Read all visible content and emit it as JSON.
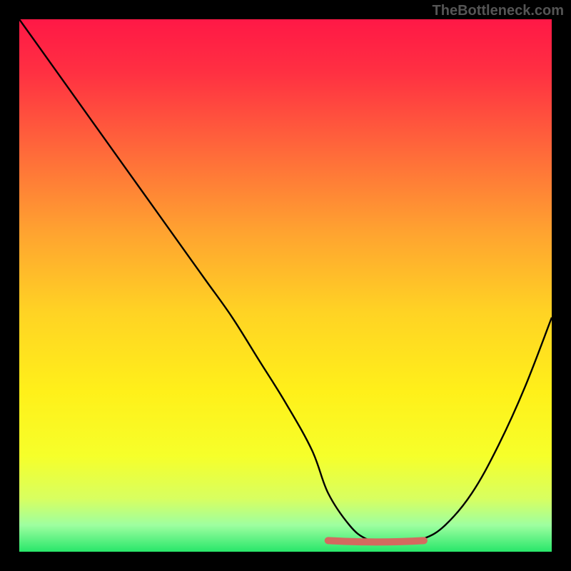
{
  "watermark": "TheBottleneck.com",
  "chart_data": {
    "type": "line",
    "title": "",
    "xlabel": "",
    "ylabel": "",
    "xlim": [
      0,
      100
    ],
    "ylim": [
      0,
      100
    ],
    "grid": false,
    "series": [
      {
        "name": "curve",
        "x": [
          0,
          5,
          10,
          15,
          20,
          25,
          30,
          35,
          40,
          45,
          50,
          55,
          58,
          62,
          65,
          68,
          72,
          76,
          80,
          85,
          90,
          95,
          100
        ],
        "y": [
          100,
          93,
          86,
          79,
          72,
          65,
          58,
          51,
          44,
          36,
          28,
          19,
          11,
          5,
          2.5,
          2.0,
          2.0,
          2.5,
          5,
          11,
          20,
          31,
          44
        ]
      }
    ],
    "flat_segment": {
      "x_start": 58,
      "x_end": 76,
      "y": 2.1,
      "color": "#d46a5f"
    },
    "gradient_stops": [
      {
        "offset": 0.0,
        "color": "#ff1846"
      },
      {
        "offset": 0.1,
        "color": "#ff3042"
      },
      {
        "offset": 0.25,
        "color": "#ff6a3a"
      },
      {
        "offset": 0.4,
        "color": "#ffa330"
      },
      {
        "offset": 0.55,
        "color": "#ffd324"
      },
      {
        "offset": 0.7,
        "color": "#fff01a"
      },
      {
        "offset": 0.82,
        "color": "#f6ff2a"
      },
      {
        "offset": 0.9,
        "color": "#d8ff60"
      },
      {
        "offset": 0.95,
        "color": "#9effa0"
      },
      {
        "offset": 1.0,
        "color": "#28e66a"
      }
    ]
  }
}
